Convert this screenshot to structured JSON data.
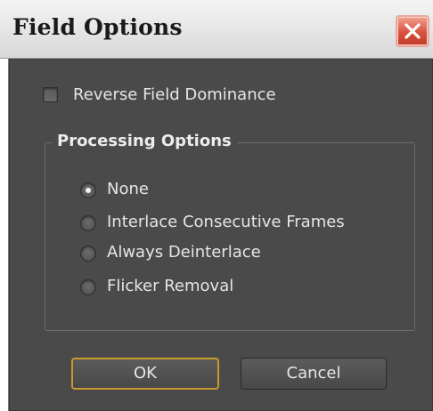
{
  "dialog": {
    "title": "Field Options",
    "close_icon": "close-icon"
  },
  "options": {
    "reverse_field_dominance": {
      "label": "Reverse Field Dominance",
      "checked": false
    },
    "processing": {
      "title": "Processing Options",
      "selected": "None",
      "items": [
        {
          "label": "None",
          "checked": true
        },
        {
          "label": "Interlace Consecutive Frames",
          "checked": false
        },
        {
          "label": "Always Deinterlace",
          "checked": false
        },
        {
          "label": "Flicker Removal",
          "checked": false
        }
      ]
    }
  },
  "buttons": {
    "ok_label": "OK",
    "cancel_label": "Cancel"
  },
  "colors": {
    "panel_bg": "#4a4a4a",
    "text": "#e6e6e6",
    "ok_focus_border": "#c79a2a",
    "close_button": "#d8523e"
  }
}
